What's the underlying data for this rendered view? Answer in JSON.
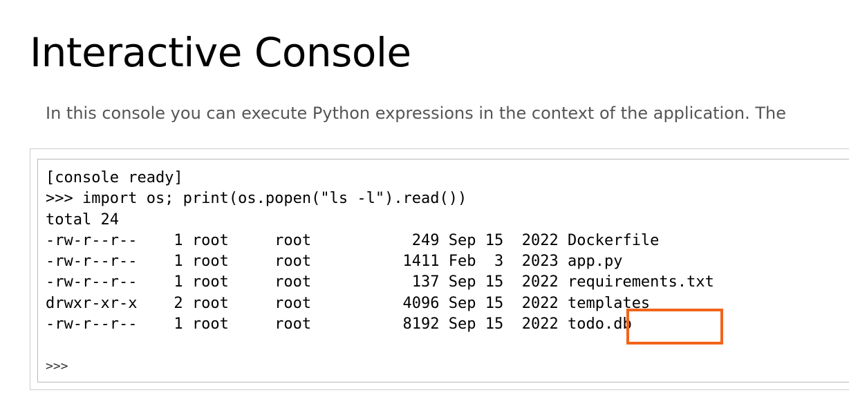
{
  "page": {
    "title": "Interactive Console",
    "intro": "In this console you can execute Python expressions in the context of the application. The"
  },
  "console": {
    "lines": [
      "[console ready]",
      ">>> import os; print(os.popen(\"ls -l\").read())",
      "total 24",
      "-rw-r--r--    1 root     root           249 Sep 15  2022 Dockerfile",
      "-rw-r--r--    1 root     root          1411 Feb  3  2023 app.py",
      "-rw-r--r--    1 root     root           137 Sep 15  2022 requirements.txt",
      "drwxr-xr-x    2 root     root          4096 Sep 15  2022 templates",
      "-rw-r--r--    1 root     root          8192 Sep 15  2022 todo.db"
    ],
    "prompt": ">>>",
    "input_value": ""
  },
  "annotation": {
    "highlighted_item": "todo.db",
    "color": "#f26419"
  }
}
